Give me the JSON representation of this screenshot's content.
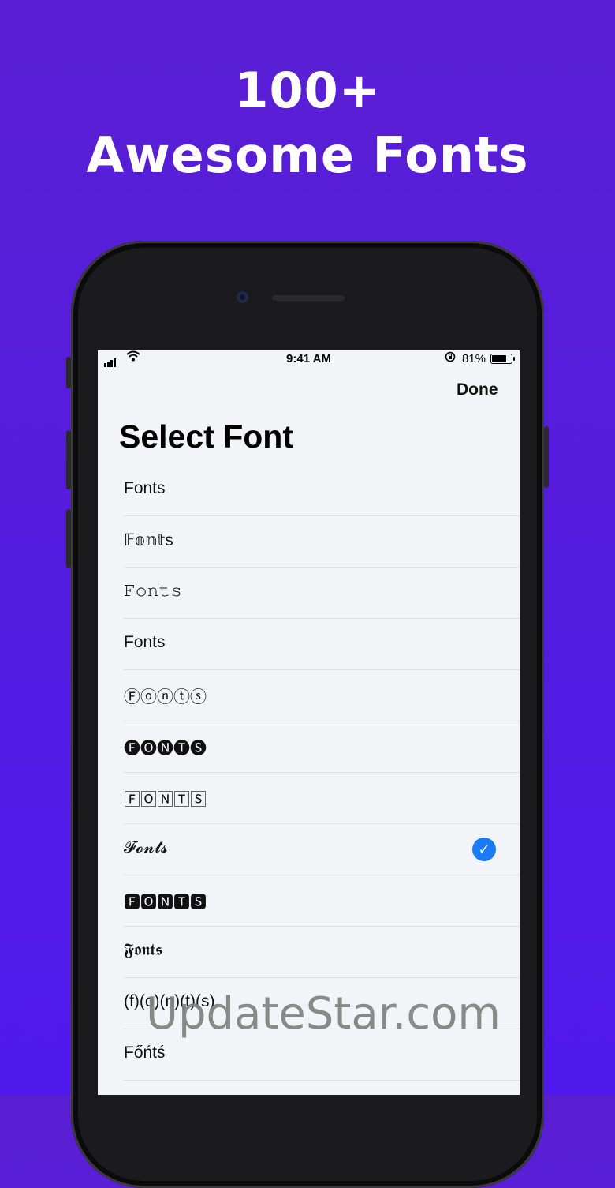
{
  "headline": {
    "line1": "100+",
    "line2": "Awesome Fonts"
  },
  "status_bar": {
    "time": "9:41 AM",
    "battery_percent": "81%",
    "battery_level": 0.81
  },
  "nav": {
    "done_label": "Done"
  },
  "page": {
    "title": "Select Font"
  },
  "fonts": [
    {
      "label": "Fonts",
      "selected": false
    },
    {
      "label": "𝔽𝕠𝕟𝕥s",
      "selected": false
    },
    {
      "label": "𝙵𝚘𝚗𝚝𝚜",
      "selected": false
    },
    {
      "label": "Fonts",
      "selected": false
    },
    {
      "label": "Ⓕⓞⓝⓣⓢ",
      "selected": false
    },
    {
      "label": "🅕🅞🅝🅣🅢",
      "selected": false
    },
    {
      "label": "🄵🄾🄽🅃🅂",
      "selected": false
    },
    {
      "label": "𝓕𝓸𝓷𝓽𝓼",
      "selected": true
    },
    {
      "label": "🅵🅾🅽🆃🆂",
      "selected": false
    },
    {
      "label": "𝕱𝖔𝖓𝖙𝖘",
      "selected": false
    },
    {
      "label": "(f)(o)(n)(t)(s)",
      "selected": false
    },
    {
      "label": "Főńtś",
      "selected": false
    }
  ],
  "watermark": "UpdateStar.com",
  "icons": {
    "selected": "checkmark-icon"
  },
  "colors": {
    "accent": "#1a7cf5",
    "background_top": "#5a1fd3",
    "background_bottom": "#4f19ec"
  }
}
